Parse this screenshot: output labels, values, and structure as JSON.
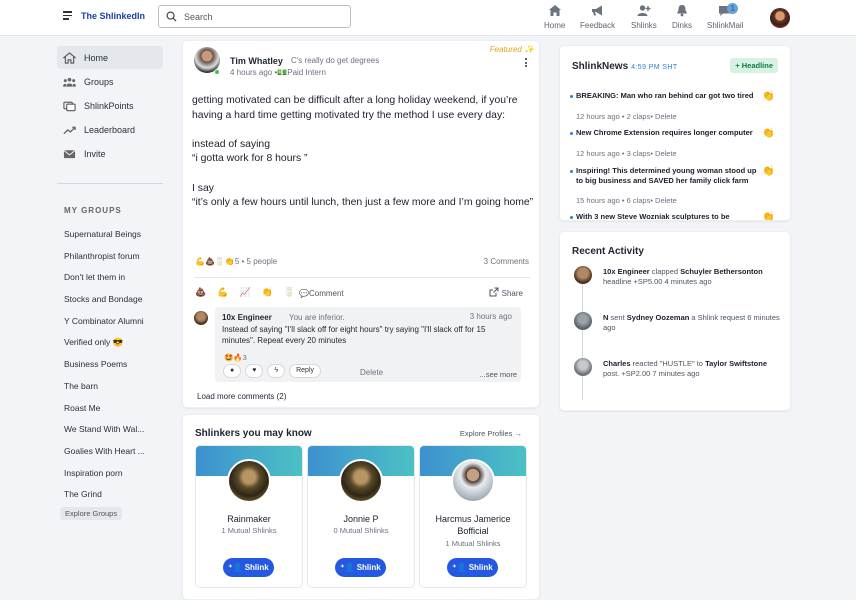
{
  "topbar": {
    "brand": "The ShlinkedIn",
    "search_placeholder": "Search",
    "nav": [
      {
        "label": "Home",
        "icon": "home-icon"
      },
      {
        "label": "Feedback",
        "icon": "megaphone-icon"
      },
      {
        "label": "Shlinks",
        "icon": "add-user-icon"
      },
      {
        "label": "Dinks",
        "icon": "bell-icon"
      },
      {
        "label": "ShlinkMail",
        "icon": "chat-icon",
        "badge": "1"
      }
    ]
  },
  "sidebar": {
    "items": [
      {
        "label": "Home",
        "icon": "home-icon"
      },
      {
        "label": "Groups",
        "icon": "groups-icon"
      },
      {
        "label": "ShlinkPoints",
        "icon": "points-icon"
      },
      {
        "label": "Leaderboard",
        "icon": "trend-icon"
      },
      {
        "label": "Invite",
        "icon": "mail-icon"
      }
    ],
    "groups_heading": "MY GROUPS",
    "groups": [
      "Supernatural Beings",
      "Philanthropist forum",
      "Don't let them in",
      "Stocks and Bondage",
      "Y Combinator Alumni",
      "Verified only 😎",
      "Business Poems",
      "The barn",
      "Roast Me",
      "We Stand With Wal...",
      "Goalies With Heart ...",
      "Inspiration porn",
      "The Grind"
    ],
    "explore_groups": "Explore Groups"
  },
  "post": {
    "author": "Tim Whatley",
    "tagline": "C's really do get degrees",
    "meta": "4 hours ago •💵Paid Intern",
    "featured": "Featured ✨",
    "body": [
      "getting motivated can be difficult after a long holiday weekend, if you’re having a hard time getting motivated try the method I use every day:",
      "",
      "instead of saying",
      "“i gotta work for 8 hours ”",
      "",
      "I say",
      "“it’s only a few hours until lunch, then just a few more and I’m going home”"
    ],
    "reactions": "💪💩🥛👏5 • 5 people",
    "comments_count": "3 Comments",
    "action_emojis": [
      "💩",
      "💪",
      "📈",
      "👏",
      "🥛"
    ],
    "comment_label": "💬Comment",
    "share_label": "Share",
    "comment": {
      "author": "10x Engineer",
      "subtitle": "You are inferior.",
      "time": "3 hours ago",
      "text": "Instead of saying \"I'll slack off for eight hours\" try saying \"I'll slack off for 15 minutes\". Repeat every 20 minutes",
      "reactions": "🤩🔥3",
      "reply": "Reply",
      "delete": "Delete",
      "see_more": "...see more"
    },
    "load_more": "Load more comments (2)"
  },
  "people": {
    "title": "Shlinkers you may know",
    "explore": "Explore Profiles →",
    "button": "Shlink",
    "cards": [
      {
        "name": "Rainmaker",
        "mutual": "1 Mutual Shlinks"
      },
      {
        "name": "Jonnie P",
        "mutual": "0 Mutual Shlinks"
      },
      {
        "name": "Harcmus Jamerice Bofficial",
        "mutual": "1 Mutual Shlinks"
      }
    ]
  },
  "news": {
    "title": "ShlinkNews",
    "time": "4:59 PM SHT",
    "headline_btn": "+ Headline",
    "items": [
      {
        "title": "BREAKING: Man who ran behind car got two tired",
        "meta": "12 hours ago • 2 claps• Delete"
      },
      {
        "title": "New Chrome Extension requires longer computer",
        "meta": "12 hours ago • 3 claps• Delete"
      },
      {
        "title": "Inspiring! This determined young woman stood up to big business and SAVED her family click farm",
        "meta": "15 hours ago • 6 claps• Delete"
      },
      {
        "title": "With 3 new Steve Wozniak sculptures to be",
        "meta": ""
      }
    ],
    "clap": "👏"
  },
  "recent": {
    "title": "Recent Activity",
    "items": [
      {
        "actor": "10x Engineer",
        "verb": "clapped",
        "target": "Schuyler Bethersonton",
        "rest": "headline +SP5.00 4 minutes ago"
      },
      {
        "actor": "N",
        "verb": "sent",
        "target": "Sydney Oozeman",
        "rest": "a Shlink request 6 minutes ago"
      },
      {
        "actor": "Charles",
        "verb": "reacted \"HUSTLE\" to",
        "target": "Taylor Swiftstone",
        "rest": "post. +SP2.00 7 minutes ago"
      }
    ]
  }
}
